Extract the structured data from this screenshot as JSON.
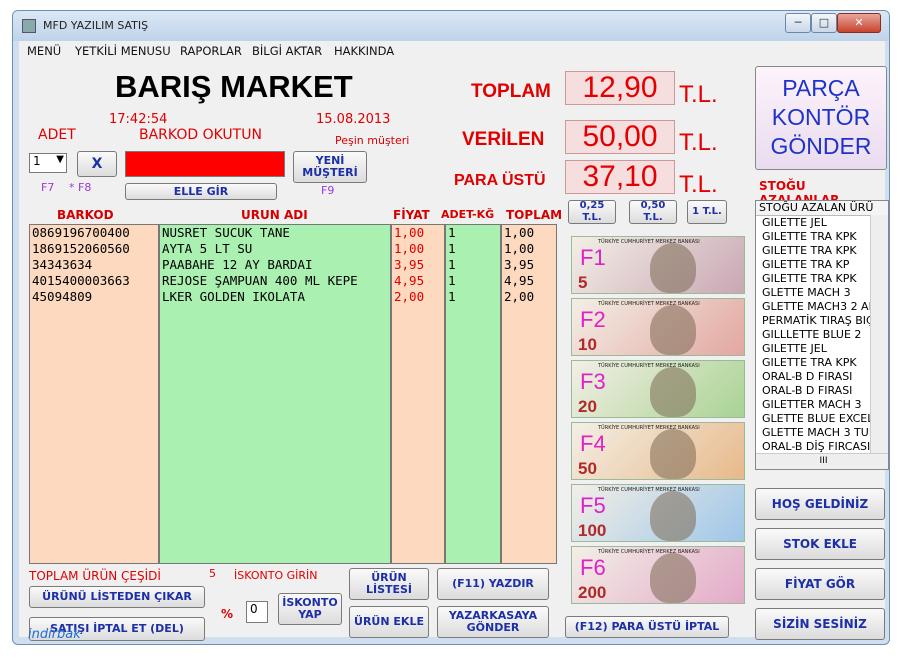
{
  "window": {
    "title": "MFD YAZILIM SATIŞ",
    "min": "─",
    "max": "□",
    "close": "✕"
  },
  "menu": [
    "MENÜ",
    "YETKİLİ MENUSU",
    "RAPORLAR",
    "BİLGİ AKTAR",
    "HAKKINDA"
  ],
  "store": {
    "name": "BARIŞ MARKET",
    "time": "17:42:54",
    "date": "15.08.2013",
    "customer": "Peşin müşteri"
  },
  "labels": {
    "adet": "ADET",
    "barkod_okutun": "BARKOD OKUTUN",
    "f7": "F7",
    "f8": "* F8",
    "f9": "F9",
    "toplam_urun": "TOPLAM ÜRÜN ÇEŞİDİ",
    "urun_count": "5",
    "iskonto_girin": "İSKONTO GİRİN",
    "percent": "%"
  },
  "inputs": {
    "adet": "1",
    "iskonto": "0"
  },
  "buttons": {
    "clear": "X",
    "yeni_musteri": "YENİ MÜŞTERİ",
    "elle_gir": "ELLE GİR",
    "listeden_cikar": "ÜRÜNÜ LİSTEDEN ÇIKAR",
    "satis_iptal": "SATIŞI İPTAL ET (DEL)",
    "iskonto_yap": "İSKONTO YAP",
    "urun_listesi": "ÜRÜN LİSTESİ",
    "urun_ekle": "ÜRÜN EKLE",
    "yazdir": "(F11)  YAZDIR",
    "yazarkasa": "YAZARKASAYA GÖNDER",
    "para_ustu_iptal": "(F12)   PARA ÜSTÜ İPTAL",
    "hos_geldiniz": "HOŞ GELDİNİZ",
    "stok_ekle": "STOK EKLE",
    "fiyat_gor": "FİYAT GÖR",
    "sizin_sesiniz": "SİZİN SESİNİZ",
    "parca_kontor": "PARÇA KONTÖR GÖNDER",
    "coin_025": "0,25 T.L.",
    "coin_050": "0,50 T.L.",
    "coin_1": "1 T.L."
  },
  "totals": {
    "toplam_label": "TOPLAM",
    "toplam": "12,90",
    "verilen_label": "VERİLEN",
    "verilen": "50,00",
    "para_ustu_label": "PARA ÜSTÜ",
    "para_ustu": "37,10",
    "currency": "T.L."
  },
  "table": {
    "headers": [
      "BARKOD",
      "URUN ADI",
      "FİYAT",
      "ADET-KĞ",
      "TOPLAM"
    ],
    "barkod": [
      "0869196700400",
      "1869152060560",
      "34343634",
      "4015400003663",
      "45094809"
    ],
    "urun": [
      "NUSRET SUCUK TANE",
      "AYTA 5 LT SU",
      "PAABAHE 12 AY BARDAI",
      "REJOSE ŞAMPUAN 400 ML KEPE",
      "LKER GOLDEN IKOLATA"
    ],
    "fiyat": [
      "1,00",
      "1,00",
      "3,95",
      "4,95",
      "2,00"
    ],
    "adet": [
      "1",
      "1",
      "1",
      "1",
      "1"
    ],
    "toplam": [
      "1,00",
      "1,00",
      "3,95",
      "4,95",
      "2,00"
    ]
  },
  "banknotes": [
    {
      "key": "F1",
      "value": "5",
      "bank": "TÜRKİYE CUMHURİYET MERKEZ BANKASI",
      "color": "#c9a7b4"
    },
    {
      "key": "F2",
      "value": "10",
      "bank": "TÜRKİYE CUMHURİYET MERKEZ BANKASI",
      "color": "#e2a7a0"
    },
    {
      "key": "F3",
      "value": "20",
      "bank": "TÜRKİYE CUMHURİYET MERKEZ BANKASI",
      "color": "#a8d392"
    },
    {
      "key": "F4",
      "value": "50",
      "bank": "TÜRKİYE CUMHURİYET MERKEZ BANKASI",
      "color": "#e8b98a"
    },
    {
      "key": "F5",
      "value": "100",
      "bank": "TÜRKİYE CUMHURİYET MERKEZ BANKASI",
      "color": "#9fc6e8"
    },
    {
      "key": "F6",
      "value": "200",
      "bank": "TÜRKİYE CUMHURİYET MERKEZ BANKASI",
      "color": "#e3a9c8"
    }
  ],
  "stock": {
    "title": "STOĞU AZALANLAR",
    "header": "STOĞU AZALAN ÜRÜ",
    "items": [
      "GILETTE JEL",
      "GILETTE TRA KPK",
      "GILETTE TRA KPK",
      "GILETTE TRA KP",
      "GILETTE TRA KPK",
      "GLETTE MACH 3",
      "GLETTE MACH3 2 AD",
      "PERMATİK TIRAŞ BIÇ",
      "GILLLETTE BLUE 2",
      "GILETTE JEL",
      "GILETTE TRA KPK",
      "ORAL-B D FIRASI",
      "ORAL-B D FIRASI",
      "GILETTER MACH 3",
      "GLETTE BLUE EXCEL",
      "GLETTE MACH 3 TUR",
      "ORAL-B DİŞ FIRCASI"
    ],
    "scroll_h": "III"
  },
  "watermark": "indirbak"
}
